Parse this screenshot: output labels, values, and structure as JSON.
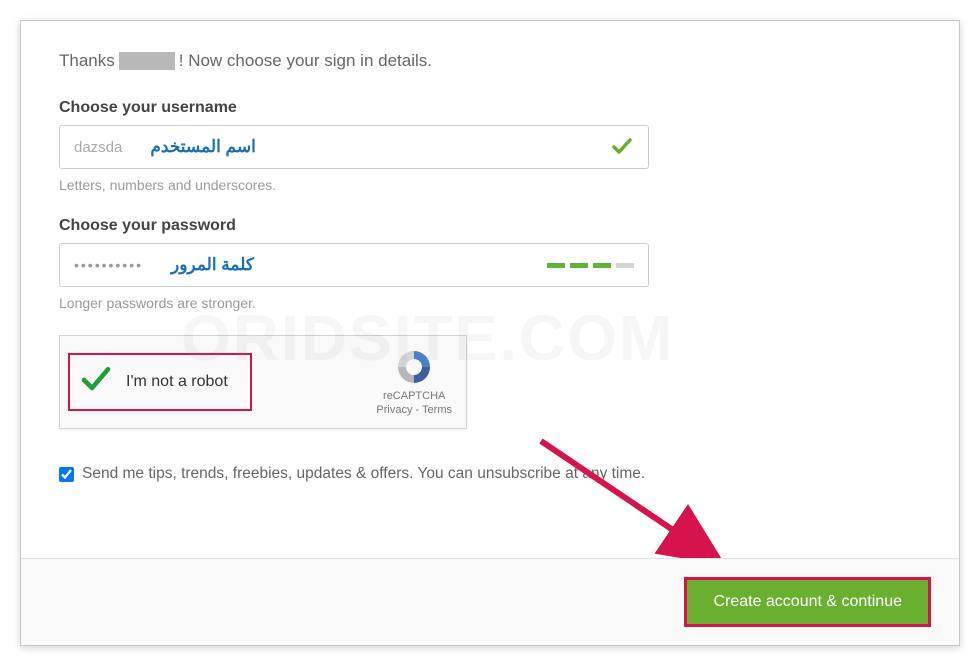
{
  "greeting": {
    "prefix": "Thanks",
    "suffix": "! Now choose your sign in details."
  },
  "username": {
    "label": "Choose your username",
    "value": "dazsda",
    "annotation_ar": "اسم المستخدم",
    "help": "Letters, numbers and underscores."
  },
  "password": {
    "label": "Choose your password",
    "value_mask": "••••••••••",
    "annotation_ar": "كلمة المرور",
    "help": "Longer passwords are stronger."
  },
  "recaptcha": {
    "label": "I'm not a robot",
    "brand": "reCAPTCHA",
    "links": "Privacy - Terms"
  },
  "newsletter": {
    "text": "Send me tips, trends, freebies, updates & offers. You can unsubscribe at any time.",
    "checked": true
  },
  "cta": {
    "label": "Create account & continue"
  },
  "watermark": "ORIDSITE.COM"
}
